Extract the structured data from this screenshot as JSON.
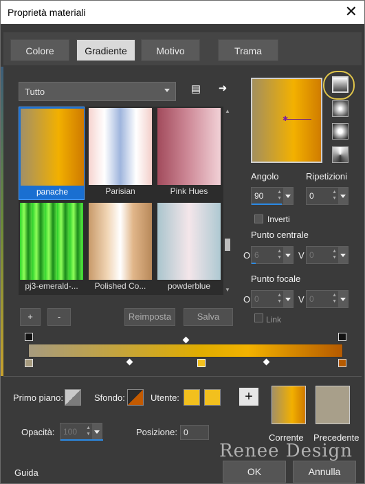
{
  "window": {
    "title": "Proprietà materiali",
    "close_icon": "close-icon"
  },
  "tabs": [
    {
      "label": "Colore",
      "active": false
    },
    {
      "label": "Gradiente",
      "active": true
    },
    {
      "label": "Motivo",
      "active": false
    },
    {
      "label": "Trama",
      "active": false
    }
  ],
  "category": {
    "value": "Tutto"
  },
  "gradients": [
    {
      "label": "panache",
      "selected": true
    },
    {
      "label": "Parisian",
      "selected": false
    },
    {
      "label": "Pink Hues",
      "selected": false
    },
    {
      "label": "pj3-emerald-...",
      "selected": false
    },
    {
      "label": "Polished Co...",
      "selected": false
    },
    {
      "label": "powderblue",
      "selected": false
    }
  ],
  "buttons": {
    "add": "+",
    "remove": "-",
    "reset": "Reimposta",
    "save": "Salva",
    "ok": "OK",
    "cancel": "Annulla",
    "help": "Guida"
  },
  "settings": {
    "angle_label": "Angolo",
    "angle_value": "90",
    "repeat_label": "Ripetizioni",
    "repeat_value": "0",
    "invert_label": "Inverti",
    "center_label": "Punto centrale",
    "center_o": "6",
    "center_v": "0",
    "focal_label": "Punto focale",
    "focal_o": "0",
    "focal_v": "0",
    "link_label": "Link",
    "o_label": "O",
    "v_label": "V"
  },
  "bottom": {
    "foreground_label": "Primo piano:",
    "background_label": "Sfondo:",
    "user_label": "Utente:",
    "opacity_label": "Opacità:",
    "opacity_value": "100",
    "position_label": "Posizione:",
    "position_value": "0",
    "current_label": "Corrente",
    "previous_label": "Precedente"
  },
  "watermark": "Renee Design",
  "colors": {
    "user_color": "#f2c01e",
    "previous_swatch": "#a89f8a"
  }
}
